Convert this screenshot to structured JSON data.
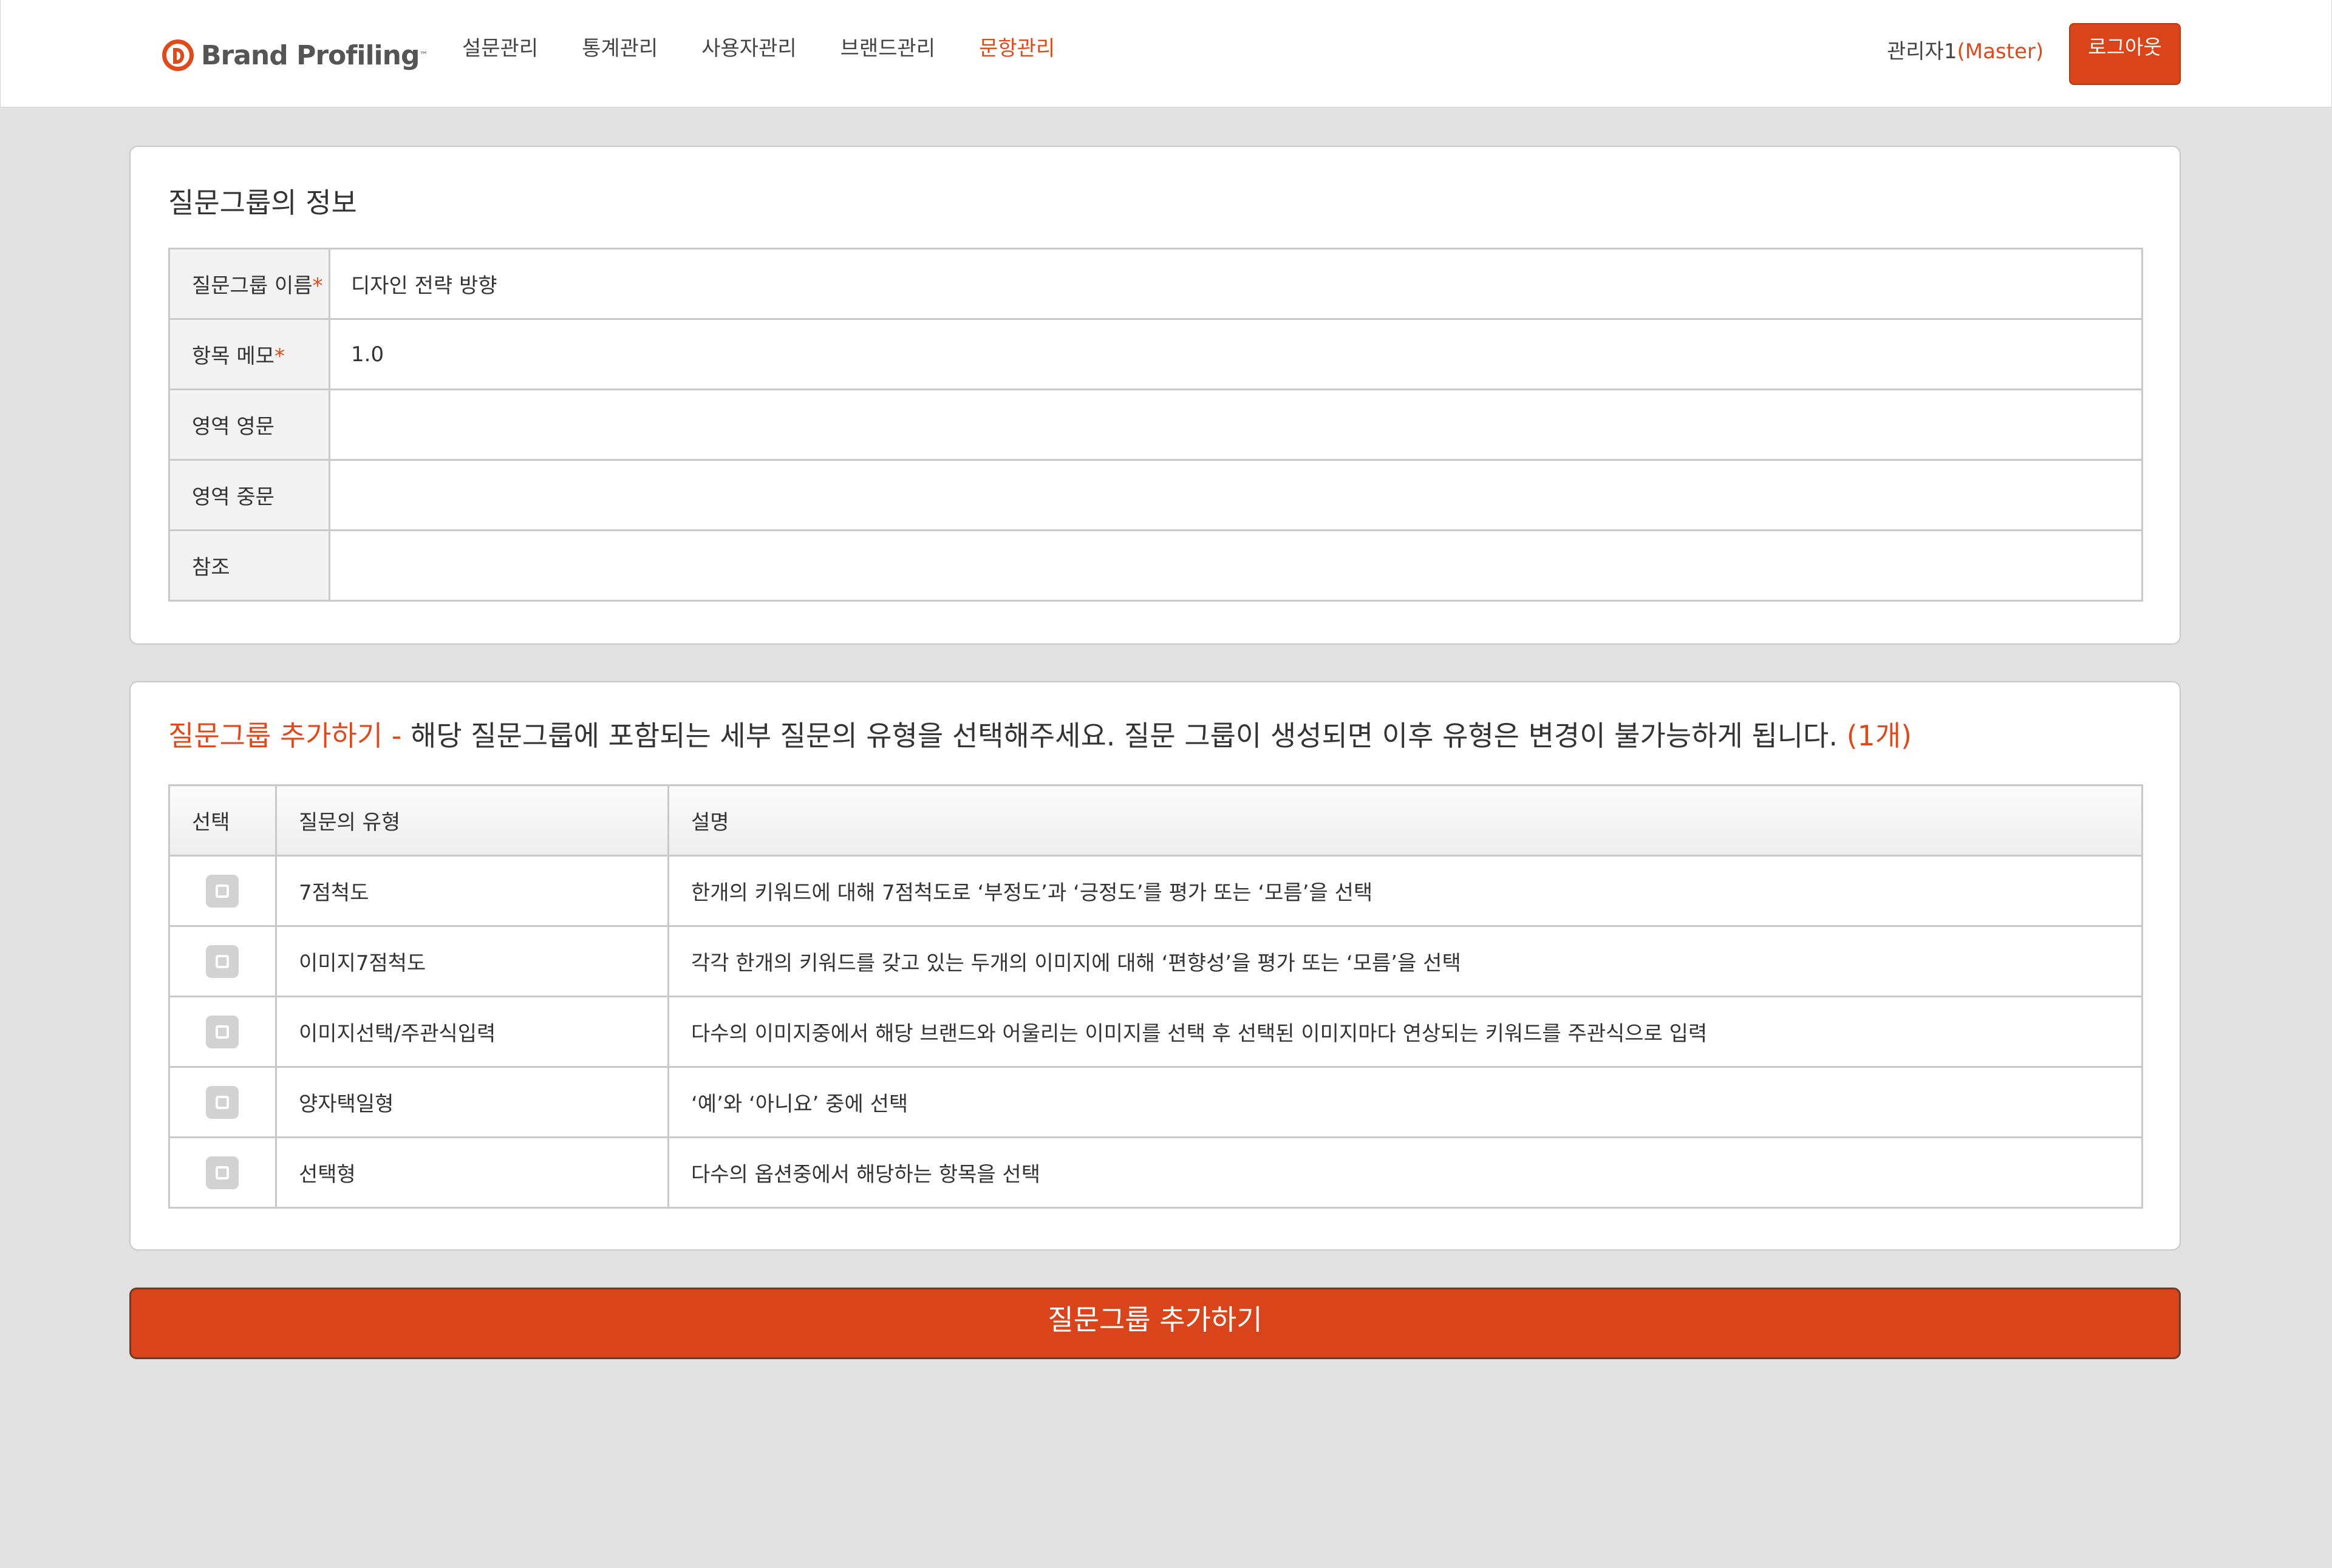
{
  "header": {
    "logo_text": "Brand Profiling",
    "logo_tm": "™",
    "nav": [
      {
        "label": "설문관리",
        "active": false
      },
      {
        "label": "통계관리",
        "active": false
      },
      {
        "label": "사용자관리",
        "active": false
      },
      {
        "label": "브랜드관리",
        "active": false
      },
      {
        "label": "문항관리",
        "active": true
      }
    ],
    "user_name": "관리자1",
    "user_role": "(Master)",
    "logout_label": "로그아웃"
  },
  "group_info": {
    "title": "질문그룹의 정보",
    "rows": [
      {
        "label": "질문그룹 이름",
        "required": "*",
        "value": "디자인 전략 방향"
      },
      {
        "label": "항목 메모",
        "required": "*",
        "value": "1.0"
      },
      {
        "label": "영역 영문",
        "required": "",
        "value": ""
      },
      {
        "label": "영역 중문",
        "required": "",
        "value": ""
      },
      {
        "label": "참조",
        "required": "",
        "value": ""
      }
    ]
  },
  "add_group": {
    "title_accent": "질문그룹 추가하기 -",
    "title_text": " 해당 질문그룹에 포함되는 세부 질문의 유형을 선택해주세요. 질문 그룹이 생성되면 이후 유형은 변경이 불가능하게 됩니다. ",
    "count": "(1개)",
    "columns": [
      "선택",
      "질문의 유형",
      "설명"
    ],
    "rows": [
      {
        "type": "7점척도",
        "desc": "한개의 키워드에 대해 7점척도로 ‘부정도’과 ‘긍정도’를 평가 또는 ‘모름’을 선택",
        "checked": false
      },
      {
        "type": "이미지7점척도",
        "desc": "각각 한개의 키워드를 갖고 있는 두개의 이미지에 대해 ‘편향성’을 평가 또는 ‘모름’을 선택",
        "checked": false
      },
      {
        "type": "이미지선택/주관식입력",
        "desc": "다수의 이미지중에서 해당 브랜드와 어울리는 이미지를 선택 후 선택된 이미지마다 연상되는 키워드를 주관식으로 입력",
        "checked": false
      },
      {
        "type": "양자택일형",
        "desc": "‘예’와 ‘아니요’ 중에 선택",
        "checked": false
      },
      {
        "type": "선택형",
        "desc": "다수의 옵션중에서 해당하는 항목을 선택",
        "checked": false
      }
    ]
  },
  "submit_label": "질문그룹 추가하기",
  "colors": {
    "accent": "#e04a1a",
    "button": "#d9441a",
    "background": "#e1e1e1"
  }
}
